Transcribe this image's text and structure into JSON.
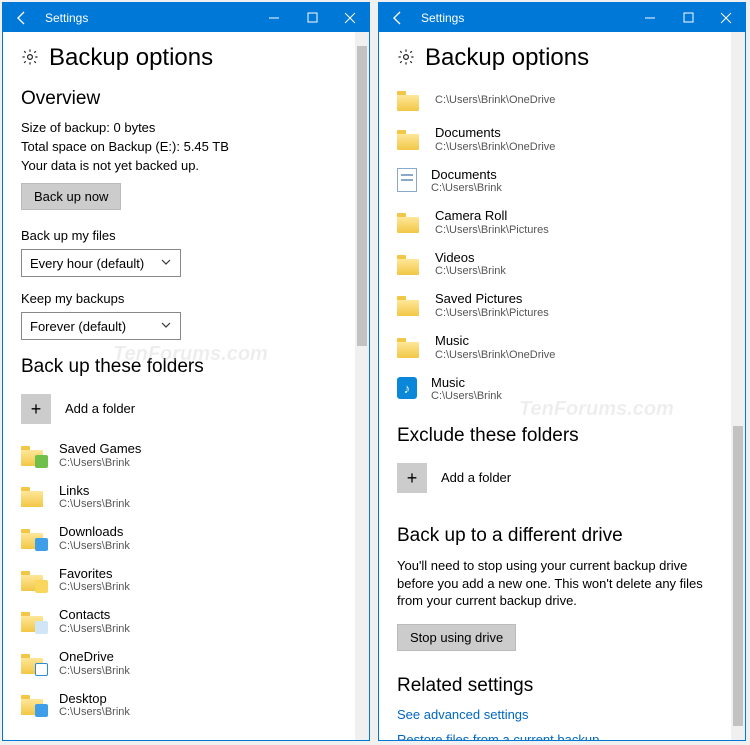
{
  "titlebar": {
    "title": "Settings"
  },
  "header": {
    "page_title": "Backup options"
  },
  "left": {
    "overview": {
      "heading": "Overview",
      "size_line": "Size of backup: 0 bytes",
      "space_line": "Total space on Backup (E:): 5.45 TB",
      "status_line": "Your data is not yet backed up.",
      "backup_now": "Back up now"
    },
    "freq": {
      "label": "Back up my files",
      "value": "Every hour (default)"
    },
    "keep": {
      "label": "Keep my backups",
      "value": "Forever (default)"
    },
    "backup_folders": {
      "heading": "Back up these folders",
      "add": "Add a folder",
      "items": [
        {
          "name": "Saved Games",
          "path": "C:\\Users\\Brink",
          "icon": "folder",
          "overlay": "green"
        },
        {
          "name": "Links",
          "path": "C:\\Users\\Brink",
          "icon": "folder",
          "overlay": ""
        },
        {
          "name": "Downloads",
          "path": "C:\\Users\\Brink",
          "icon": "folder",
          "overlay": "blue"
        },
        {
          "name": "Favorites",
          "path": "C:\\Users\\Brink",
          "icon": "folder",
          "overlay": "star"
        },
        {
          "name": "Contacts",
          "path": "C:\\Users\\Brink",
          "icon": "folder",
          "overlay": "contact"
        },
        {
          "name": "OneDrive",
          "path": "C:\\Users\\Brink",
          "icon": "folder",
          "overlay": "cloud"
        },
        {
          "name": "Desktop",
          "path": "C:\\Users\\Brink",
          "icon": "folder",
          "overlay": "blue"
        }
      ]
    }
  },
  "right": {
    "cont_items": [
      {
        "name": "",
        "path": "C:\\Users\\Brink\\OneDrive",
        "icon": "folder",
        "overlay": ""
      },
      {
        "name": "Documents",
        "path": "C:\\Users\\Brink\\OneDrive",
        "icon": "folder",
        "overlay": ""
      },
      {
        "name": "Documents",
        "path": "C:\\Users\\Brink",
        "icon": "doc",
        "overlay": ""
      },
      {
        "name": "Camera Roll",
        "path": "C:\\Users\\Brink\\Pictures",
        "icon": "folder",
        "overlay": ""
      },
      {
        "name": "Videos",
        "path": "C:\\Users\\Brink",
        "icon": "folder",
        "overlay": ""
      },
      {
        "name": "Saved Pictures",
        "path": "C:\\Users\\Brink\\Pictures",
        "icon": "folder",
        "overlay": ""
      },
      {
        "name": "Music",
        "path": "C:\\Users\\Brink\\OneDrive",
        "icon": "folder",
        "overlay": ""
      },
      {
        "name": "Music",
        "path": "C:\\Users\\Brink",
        "icon": "music",
        "overlay": ""
      }
    ],
    "exclude": {
      "heading": "Exclude these folders",
      "add": "Add a folder"
    },
    "diffdrive": {
      "heading": "Back up to a different drive",
      "text": "You'll need to stop using your current backup drive before you add a new one. This won't delete any files from your current backup drive.",
      "button": "Stop using drive"
    },
    "related": {
      "heading": "Related settings",
      "link1": "See advanced settings",
      "link2": "Restore files from a current backup"
    }
  },
  "watermark": "TenForums.com"
}
